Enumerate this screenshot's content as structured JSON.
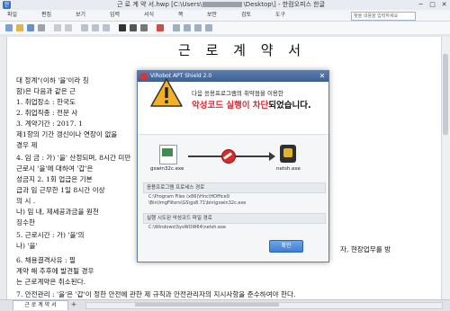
{
  "window": {
    "title_start": "근 로 계 약 서.hwp [C:\\Users\\",
    "title_end": "\\Desktop\\] - 한컴오피스 한글",
    "app_icon": "한",
    "minimize": "─",
    "maximize": "□",
    "close": "✕"
  },
  "menubar": {
    "items": [
      "파일",
      "편집",
      "보기",
      "입력",
      "서식",
      "쪽",
      "보안",
      "검토",
      "도구"
    ],
    "help_placeholder": "찾을 내용을 입력하세요"
  },
  "document": {
    "title": "근 로 계 약 서",
    "lines": [
      "대                                                                                            정계\"(이하 '을'이라 칭",
      "함)은 다음과 같은 근",
      "1. 취업장소 : 한국도",
      "2. 취업직종 : 전문 사",
      "3. 계약기간 : 2017. 1",
      "        제1항의 기간                                                            갱신이나 연장이 없을",
      "        경우 제",
      "4. 임      금 : 가) '을'                                                        산정되며, 8시간 미만",
      "        근로시                                                                      '을'에 대하여 '갑'은",
      "        성금지                                                              2. 1회 업급은 기본",
      "        급과 임                                                                      근무한 1일 8시간 이상",
      "        의 시                                                                              .",
      "        나) 임                                                                    내, 제세공과금을 원천",
      "        징수한",
      "5. 근로시간 : 가) '을'의",
      "        나) '을'",
      "6. 채용결격사유 : 필",
      "        계약 해                                                                  추후에 발견될 경우",
      "        는 근로계약은 취소된다.",
      "7. 안전관리 : '을'은 '갑'이 정한 안전에 관한 제 규칙과 안전관리자의 지시사항을 준수하여야 한다."
    ],
    "right_tail": [
      "자, 현장업무를 방"
    ]
  },
  "statusbar": {
    "tab_label": "근 로 계 약 서",
    "add_tab": "+"
  },
  "dialog": {
    "title": "ViRobot APT Shield 2.0",
    "close": "✕",
    "message_line1": "다음 응용프로그램의 취약점을 이용한",
    "message_red": "악성코드 실행이 차단",
    "message_suffix": "되었습니다.",
    "source_process": "gswin32c.exe",
    "target_process": "netsh.exe",
    "app_path_label": "응용프로그램 프로세스 경로",
    "app_path_line1": "C:\\Program Files (x86)\\Hnc\\HOffice9",
    "app_path_line2": "\\Bin\\ImgFilters\\GS\\gs8.71\\bin\\gswin32c.exe",
    "malware_path_label": "실행 시도된 악성코드 파일 경로",
    "malware_path": "C:\\Windows\\SysWOW64\\netsh.exe",
    "ok_label": "확인"
  },
  "colors": {
    "dialog_header": "#3e5f90",
    "warning_yellow": "#f2b124",
    "alert_red": "#e0282d",
    "ok_button": "#3f7fd3"
  }
}
